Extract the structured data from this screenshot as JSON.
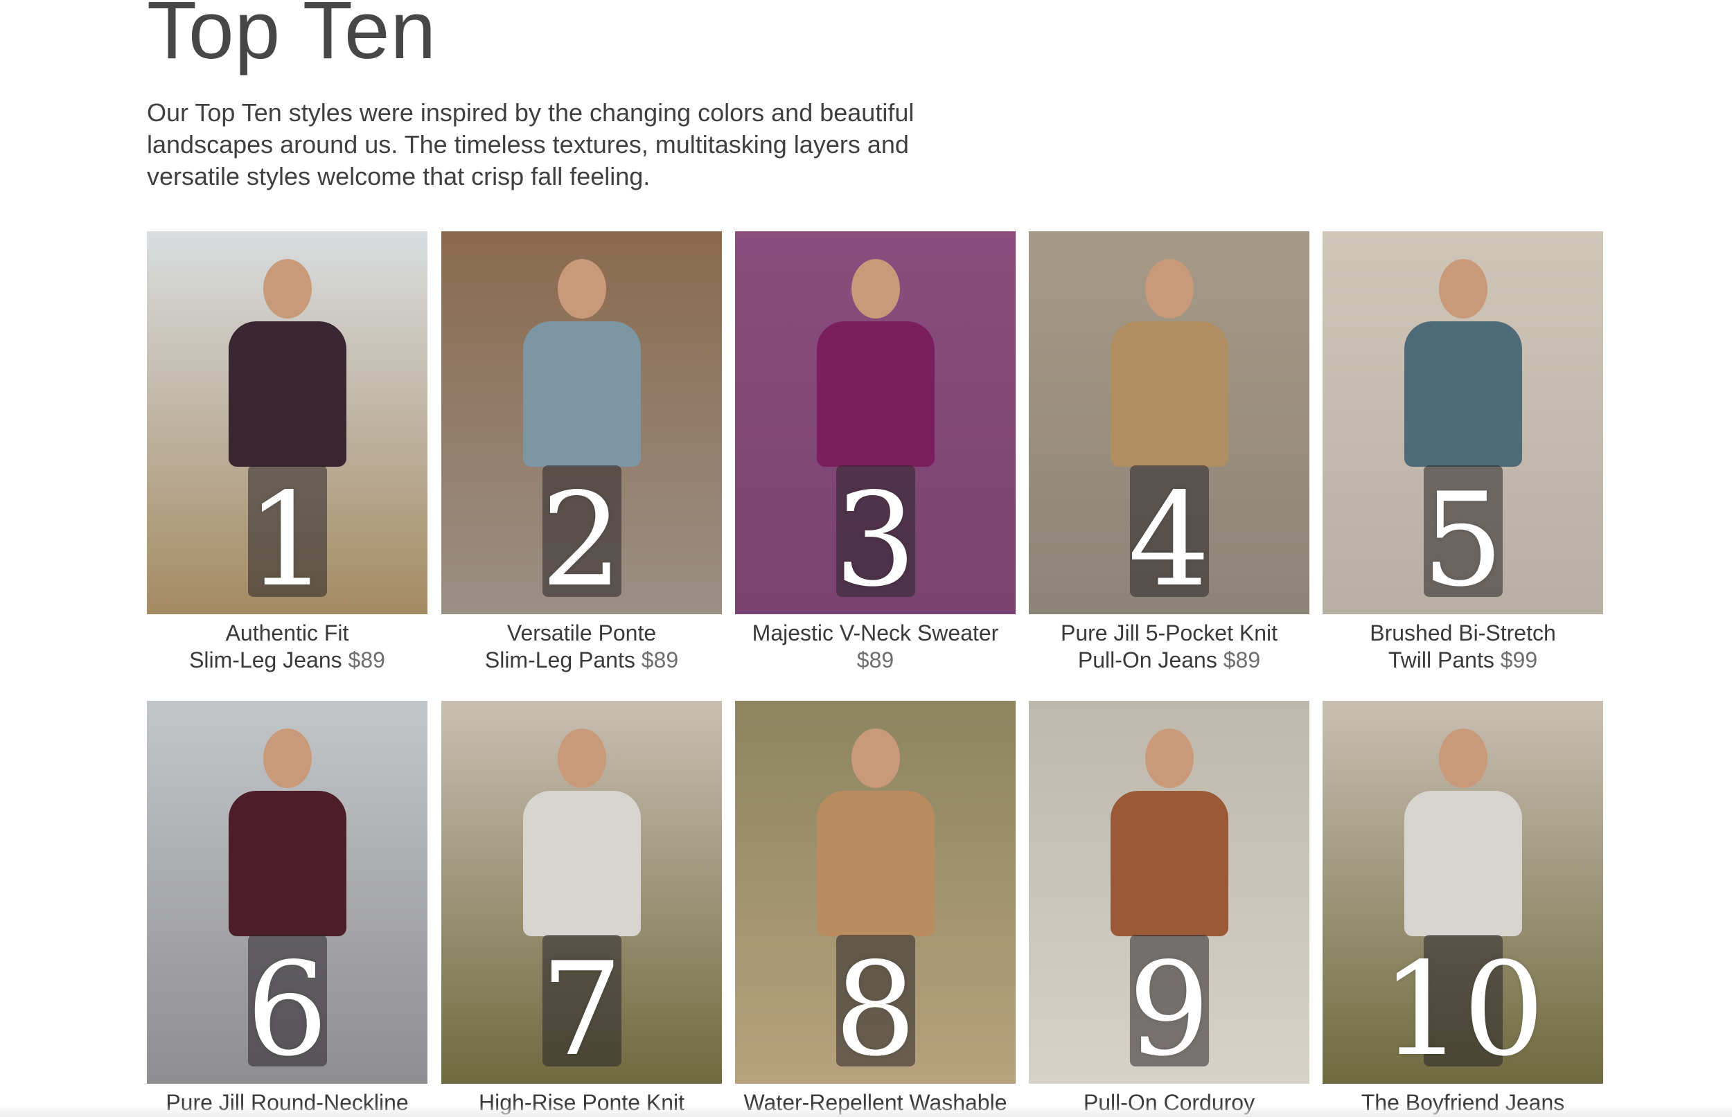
{
  "header": {
    "title": "Top Ten",
    "intro": "Our Top Ten styles were inspired by the changing colors and beautiful landscapes around us. The timeless textures, multitasking layers and versatile styles welcome that crisp fall feeling."
  },
  "products": [
    {
      "number": "1",
      "name_line1": "Authentic Fit",
      "name_line2": "Slim-Leg Jeans",
      "price": "$89",
      "photo": "woman on coastal cliff in dark sweater and slim jeans",
      "colors": {
        "bg_top": "#d9dde0",
        "bg_bottom": "#a48a62",
        "outfit": "#3a2630"
      }
    },
    {
      "number": "2",
      "name_line1": "Versatile Ponte",
      "name_line2": "Slim-Leg Pants",
      "price": "$89",
      "photo": "woman seated in blue cable sweater and brown pants",
      "colors": {
        "bg_top": "#8a6a4e",
        "bg_bottom": "#9b8f84",
        "outfit": "#7c97a3"
      }
    },
    {
      "number": "3",
      "name_line1": "Majestic V-Neck Sweater",
      "name_line2": "",
      "price": "$89",
      "photo": "woman in magenta v-neck sweater on purple backdrop",
      "colors": {
        "bg_top": "#8a4d7e",
        "bg_bottom": "#7a4270",
        "outfit": "#7b1f5c"
      }
    },
    {
      "number": "4",
      "name_line1": "Pure Jill 5-Pocket Knit",
      "name_line2": "Pull-On Jeans",
      "price": "$89",
      "photo": "woman seated in camel sweater and charcoal jeans",
      "colors": {
        "bg_top": "#a69a86",
        "bg_bottom": "#8d8478",
        "outfit": "#b08e62"
      }
    },
    {
      "number": "5",
      "name_line1": "Brushed Bi-Stretch",
      "name_line2": "Twill Pants",
      "price": "$99",
      "photo": "woman seated on table in blue sweater and grey pants",
      "colors": {
        "bg_top": "#cfc6b8",
        "bg_bottom": "#b8afa3",
        "outfit": "#4e6b7a"
      }
    },
    {
      "number": "6",
      "name_line1": "Pure Jill Round-Neckline",
      "name_line2": "",
      "price": "",
      "photo": "woman in burgundy sweater and paisley scarf",
      "colors": {
        "bg_top": "#c3c6c9",
        "bg_bottom": "#8e8d8f",
        "outfit": "#4b1e2a"
      }
    },
    {
      "number": "7",
      "name_line1": "High-Rise Ponte Knit",
      "name_line2": "",
      "price": "",
      "photo": "woman in light grey tunic sweater and dark leggings by rocks",
      "colors": {
        "bg_top": "#c9bfb2",
        "bg_bottom": "#6f6a3f",
        "outfit": "#d8d4cf"
      }
    },
    {
      "number": "8",
      "name_line1": "Water-Repellent Washable",
      "name_line2": "",
      "price": "",
      "photo": "woman crouching in camel puffer vest in dry grass",
      "colors": {
        "bg_top": "#8c8560",
        "bg_bottom": "#b7a27d",
        "outfit": "#b98c5f"
      }
    },
    {
      "number": "9",
      "name_line1": "Pull-On Corduroy",
      "name_line2": "",
      "price": "",
      "photo": "woman seated in leather chair in rust corduroy pants",
      "colors": {
        "bg_top": "#bdb7ac",
        "bg_bottom": "#d7d2c8",
        "outfit": "#9a5a36"
      }
    },
    {
      "number": "10",
      "name_line1": "The Boyfriend Jeans",
      "name_line2": "",
      "price": "",
      "photo": "woman in light grey tunic sweater and dark jeans by rocks",
      "colors": {
        "bg_top": "#c9bfb2",
        "bg_bottom": "#6f6a3f",
        "outfit": "#d8d4cf"
      }
    }
  ]
}
